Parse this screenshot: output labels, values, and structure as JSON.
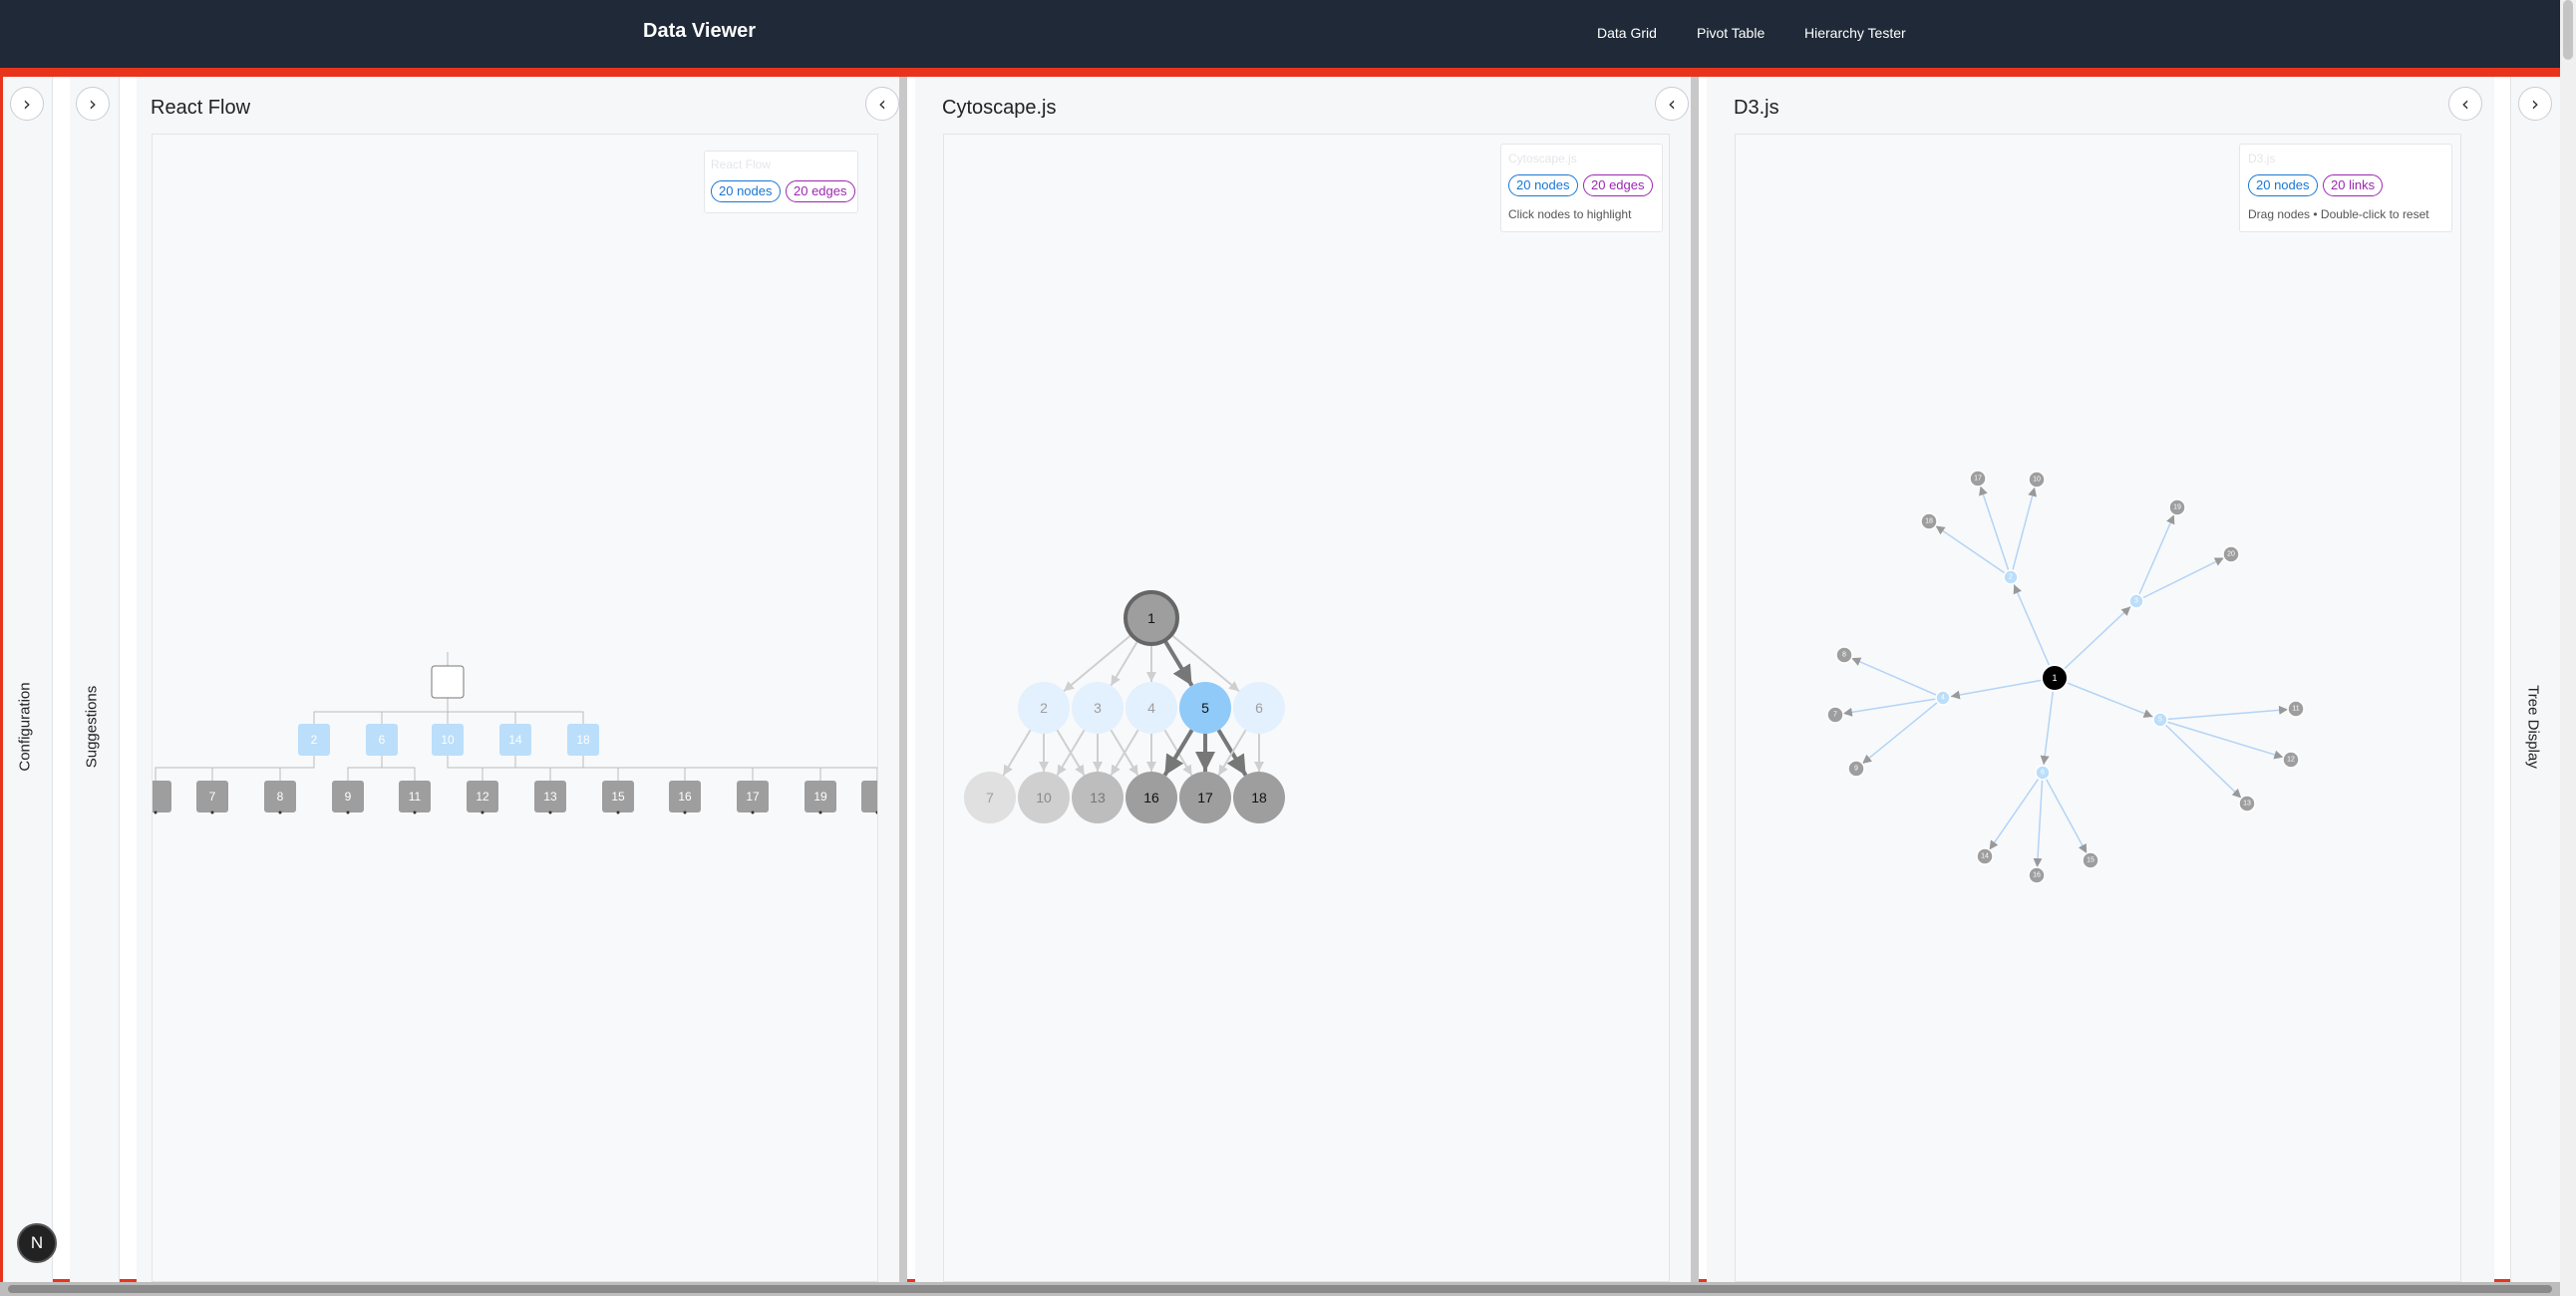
{
  "header": {
    "title": "Data Viewer",
    "nav": [
      "Data Grid",
      "Pivot Table",
      "Hierarchy Tester"
    ]
  },
  "sidebars": {
    "configuration": "Configuration",
    "suggestions": "Suggestions",
    "tree_display": "Tree Display"
  },
  "buttons": {
    "expand_glyph": "›",
    "collapse_glyph": "‹"
  },
  "panels": [
    {
      "title": "React Flow",
      "legend_title": "React Flow",
      "nodes_chip": "20 nodes",
      "edges_chip": "20 edges"
    },
    {
      "title": "Cytoscape.js",
      "legend_title": "Cytoscape.js",
      "nodes_chip": "20 nodes",
      "edges_chip": "20 edges",
      "hint": "Click nodes to highlight"
    },
    {
      "title": "D3.js",
      "legend_title": "D3.js",
      "nodes_chip": "20 nodes",
      "edges_chip": "20 links",
      "hint": "Drag nodes • Double-click to reset"
    }
  ],
  "react_flow": {
    "root": "",
    "level1": [
      "2",
      "6",
      "10",
      "14",
      "18"
    ],
    "level2": [
      "",
      "7",
      "8",
      "9",
      "11",
      "12",
      "13",
      "15",
      "16",
      "17",
      "19",
      ""
    ]
  },
  "cytoscape": {
    "root": "1",
    "level1": [
      "2",
      "3",
      "4",
      "5",
      "6"
    ],
    "level2": [
      "7",
      "10",
      "13",
      "16",
      "17",
      "18"
    ],
    "highlighted": "5"
  },
  "d3": {
    "root": "1",
    "hubs": [
      "2",
      "3",
      "4",
      "5",
      "6"
    ],
    "leaves": [
      "7",
      "8",
      "9",
      "10",
      "11",
      "12",
      "13",
      "14",
      "15",
      "16",
      "17",
      "18",
      "19",
      "20"
    ]
  },
  "colors": {
    "header_bg": "#1f2937",
    "frame": "#e8341c",
    "node_light_blue": "#bbdefb",
    "node_gray": "#9e9e9e",
    "chip_blue": "#1976d2",
    "chip_purple": "#9c27b0"
  },
  "badge": "N"
}
